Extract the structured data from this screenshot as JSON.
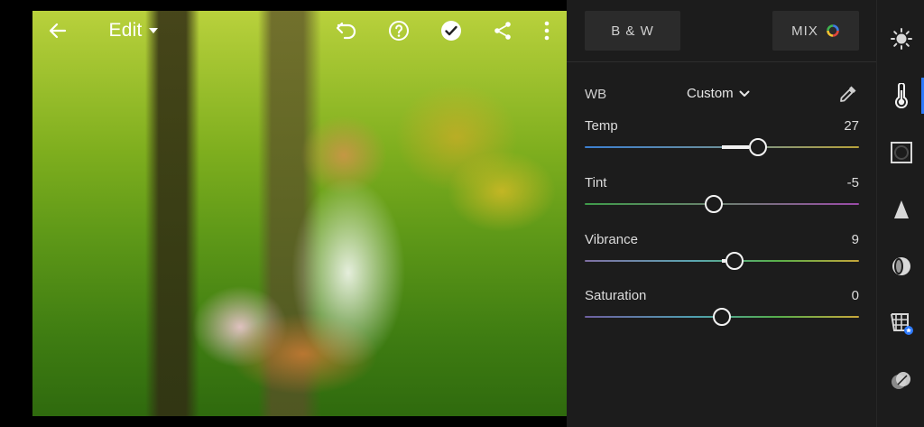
{
  "toolbar": {
    "edit_label": "Edit",
    "icons": [
      "back-arrow-icon",
      "dropdown-triangle-icon",
      "undo-icon",
      "help-icon",
      "done-check-icon",
      "share-icon",
      "more-vert-icon"
    ]
  },
  "panel": {
    "bw_button": "B & W",
    "mix_button": "MIX",
    "wb": {
      "label": "WB",
      "value": "Custom"
    },
    "sliders": [
      {
        "label": "Temp",
        "value": "27",
        "fraction": 0.63
      },
      {
        "label": "Tint",
        "value": "-5",
        "fraction": 0.47
      },
      {
        "label": "Vibrance",
        "value": "9",
        "fraction": 0.545
      },
      {
        "label": "Saturation",
        "value": "0",
        "fraction": 0.5
      }
    ]
  },
  "rail": {
    "items": [
      "light-icon",
      "color-thermometer-icon",
      "effects-vignette-icon",
      "detail-icon",
      "optics-icon",
      "geometry-icon",
      "presets-icon"
    ],
    "active": "color-thermometer-icon"
  },
  "colors": {
    "accent": "#2f7bff",
    "panel_bg": "#1c1c1c",
    "button_bg": "#2b2b2b"
  }
}
